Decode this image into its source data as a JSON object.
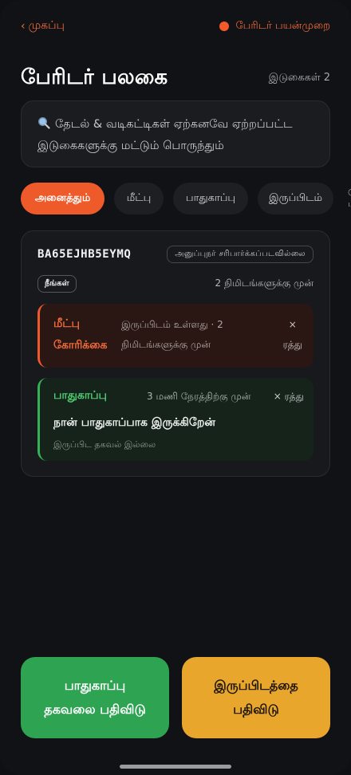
{
  "topbar": {
    "back_label": "முகப்பு",
    "mode_label": "பேரிடர் பயன்முறை"
  },
  "header": {
    "title": "பேரிடர் பலகை",
    "count_label": "இடுகைகள் 2"
  },
  "note": {
    "line1": "தேடல் & வடிகட்டிகள் ஏற்கனவே ஏற்றப்பட்ட",
    "line2": "இடுகைகளுக்கு மட்டும் பொருந்தும்"
  },
  "tabs": [
    {
      "label": "அனைத்தும்",
      "active": true
    },
    {
      "label": "மீட்பு",
      "active": false
    },
    {
      "label": "பாதுகாப்பு",
      "active": false
    },
    {
      "label": "இருப்பிடம்",
      "active": false
    },
    {
      "label": "பு",
      "active": false
    }
  ],
  "card": {
    "code": "BA65EJHB5EYMQ",
    "unverified_label": "அனுப்புநர் சரிபார்க்கப்படவில்லை",
    "you_label": "நீங்கள்",
    "ago": "2 நிமிடங்களுக்கு முன்",
    "rescue": {
      "label_line1": "மீட்பு",
      "label_line2": "கோரிக்கை",
      "meta_line1": "இருப்பிடம் உள்ளது · 2",
      "meta_line2": "நிமிடங்களுக்கு முன்",
      "cancel_icon": "×",
      "cancel_label": "ரத்து"
    },
    "safety": {
      "label": "பாதுகாப்பு",
      "meta": "3 மணி நேரத்திற்கு முன்",
      "cancel_label": "× ரத்து",
      "message": "நான் பாதுகாப்பாக இருக்கிறேன்",
      "location": "இருப்பிட தகவல் இல்லை"
    }
  },
  "buttons": {
    "safe_line1": "பாதுகாப்பு",
    "safe_line2": "தகவலை பதிவிடு",
    "loc_line1": "இருப்பிடத்தை",
    "loc_line2": "பதிவிடு"
  },
  "colors": {
    "accent": "#ef5a2a",
    "safe": "#2ea352",
    "location": "#e9a62d",
    "background": "#111215"
  }
}
